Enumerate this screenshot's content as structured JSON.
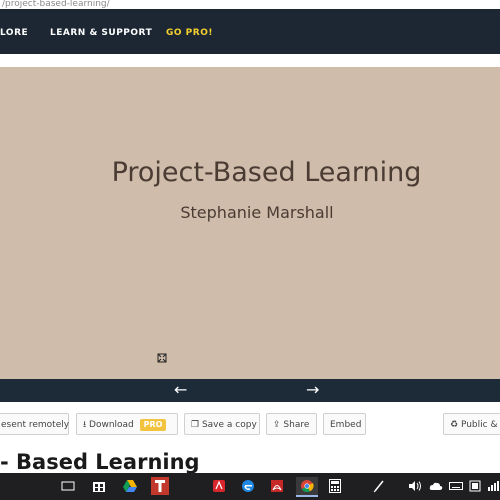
{
  "browser": {
    "url": "/project-based-learning/"
  },
  "nav": {
    "items": [
      {
        "label": "LORE"
      },
      {
        "label": "LEARN & SUPPORT"
      },
      {
        "label": "GO PRO!"
      }
    ]
  },
  "slide": {
    "title": "Project-Based Learning",
    "subtitle": "Stephanie Marshall"
  },
  "controls": {
    "prev_arrow": "←",
    "next_arrow": "→"
  },
  "actions": {
    "present_remotely": "esent remotely",
    "download": "Download",
    "download_badge": "PRO",
    "save_copy": "Save a copy",
    "share": "Share",
    "embed": "Embed",
    "public": "Public &"
  },
  "page": {
    "heading": "- Based Learning"
  },
  "taskbar": {
    "icons": [
      "task-view-icon",
      "store-icon",
      "drive-icon",
      "t-app-icon",
      "acrobat-icon",
      "edge-icon",
      "pdf-icon",
      "chrome-icon",
      "calculator-icon",
      "pen-icon",
      "volume-icon",
      "cloud-icon",
      "keyboard-icon",
      "system-icon",
      "network-icon",
      "notification-icon"
    ]
  },
  "colors": {
    "nav_bg": "#1c2733",
    "gopro": "#f5d12f",
    "slide_bg": "#cfbcab",
    "slide_text": "#4a3b33",
    "control_bar": "#1d2a38",
    "pro_badge": "#f2c33f"
  }
}
